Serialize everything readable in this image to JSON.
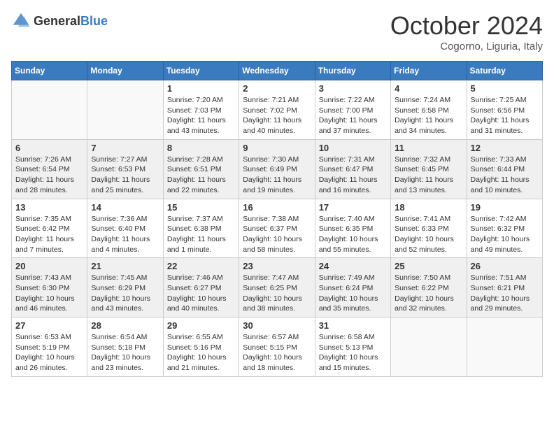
{
  "header": {
    "logo": {
      "general": "General",
      "blue": "Blue"
    },
    "title": "October 2024",
    "location": "Cogorno, Liguria, Italy"
  },
  "days_of_week": [
    "Sunday",
    "Monday",
    "Tuesday",
    "Wednesday",
    "Thursday",
    "Friday",
    "Saturday"
  ],
  "weeks": [
    [
      {
        "day": "",
        "info": ""
      },
      {
        "day": "",
        "info": ""
      },
      {
        "day": "1",
        "info": "Sunrise: 7:20 AM\nSunset: 7:03 PM\nDaylight: 11 hours and 43 minutes."
      },
      {
        "day": "2",
        "info": "Sunrise: 7:21 AM\nSunset: 7:02 PM\nDaylight: 11 hours and 40 minutes."
      },
      {
        "day": "3",
        "info": "Sunrise: 7:22 AM\nSunset: 7:00 PM\nDaylight: 11 hours and 37 minutes."
      },
      {
        "day": "4",
        "info": "Sunrise: 7:24 AM\nSunset: 6:58 PM\nDaylight: 11 hours and 34 minutes."
      },
      {
        "day": "5",
        "info": "Sunrise: 7:25 AM\nSunset: 6:56 PM\nDaylight: 11 hours and 31 minutes."
      }
    ],
    [
      {
        "day": "6",
        "info": "Sunrise: 7:26 AM\nSunset: 6:54 PM\nDaylight: 11 hours and 28 minutes."
      },
      {
        "day": "7",
        "info": "Sunrise: 7:27 AM\nSunset: 6:53 PM\nDaylight: 11 hours and 25 minutes."
      },
      {
        "day": "8",
        "info": "Sunrise: 7:28 AM\nSunset: 6:51 PM\nDaylight: 11 hours and 22 minutes."
      },
      {
        "day": "9",
        "info": "Sunrise: 7:30 AM\nSunset: 6:49 PM\nDaylight: 11 hours and 19 minutes."
      },
      {
        "day": "10",
        "info": "Sunrise: 7:31 AM\nSunset: 6:47 PM\nDaylight: 11 hours and 16 minutes."
      },
      {
        "day": "11",
        "info": "Sunrise: 7:32 AM\nSunset: 6:45 PM\nDaylight: 11 hours and 13 minutes."
      },
      {
        "day": "12",
        "info": "Sunrise: 7:33 AM\nSunset: 6:44 PM\nDaylight: 11 hours and 10 minutes."
      }
    ],
    [
      {
        "day": "13",
        "info": "Sunrise: 7:35 AM\nSunset: 6:42 PM\nDaylight: 11 hours and 7 minutes."
      },
      {
        "day": "14",
        "info": "Sunrise: 7:36 AM\nSunset: 6:40 PM\nDaylight: 11 hours and 4 minutes."
      },
      {
        "day": "15",
        "info": "Sunrise: 7:37 AM\nSunset: 6:38 PM\nDaylight: 11 hours and 1 minute."
      },
      {
        "day": "16",
        "info": "Sunrise: 7:38 AM\nSunset: 6:37 PM\nDaylight: 10 hours and 58 minutes."
      },
      {
        "day": "17",
        "info": "Sunrise: 7:40 AM\nSunset: 6:35 PM\nDaylight: 10 hours and 55 minutes."
      },
      {
        "day": "18",
        "info": "Sunrise: 7:41 AM\nSunset: 6:33 PM\nDaylight: 10 hours and 52 minutes."
      },
      {
        "day": "19",
        "info": "Sunrise: 7:42 AM\nSunset: 6:32 PM\nDaylight: 10 hours and 49 minutes."
      }
    ],
    [
      {
        "day": "20",
        "info": "Sunrise: 7:43 AM\nSunset: 6:30 PM\nDaylight: 10 hours and 46 minutes."
      },
      {
        "day": "21",
        "info": "Sunrise: 7:45 AM\nSunset: 6:29 PM\nDaylight: 10 hours and 43 minutes."
      },
      {
        "day": "22",
        "info": "Sunrise: 7:46 AM\nSunset: 6:27 PM\nDaylight: 10 hours and 40 minutes."
      },
      {
        "day": "23",
        "info": "Sunrise: 7:47 AM\nSunset: 6:25 PM\nDaylight: 10 hours and 38 minutes."
      },
      {
        "day": "24",
        "info": "Sunrise: 7:49 AM\nSunset: 6:24 PM\nDaylight: 10 hours and 35 minutes."
      },
      {
        "day": "25",
        "info": "Sunrise: 7:50 AM\nSunset: 6:22 PM\nDaylight: 10 hours and 32 minutes."
      },
      {
        "day": "26",
        "info": "Sunrise: 7:51 AM\nSunset: 6:21 PM\nDaylight: 10 hours and 29 minutes."
      }
    ],
    [
      {
        "day": "27",
        "info": "Sunrise: 6:53 AM\nSunset: 5:19 PM\nDaylight: 10 hours and 26 minutes."
      },
      {
        "day": "28",
        "info": "Sunrise: 6:54 AM\nSunset: 5:18 PM\nDaylight: 10 hours and 23 minutes."
      },
      {
        "day": "29",
        "info": "Sunrise: 6:55 AM\nSunset: 5:16 PM\nDaylight: 10 hours and 21 minutes."
      },
      {
        "day": "30",
        "info": "Sunrise: 6:57 AM\nSunset: 5:15 PM\nDaylight: 10 hours and 18 minutes."
      },
      {
        "day": "31",
        "info": "Sunrise: 6:58 AM\nSunset: 5:13 PM\nDaylight: 10 hours and 15 minutes."
      },
      {
        "day": "",
        "info": ""
      },
      {
        "day": "",
        "info": ""
      }
    ]
  ]
}
